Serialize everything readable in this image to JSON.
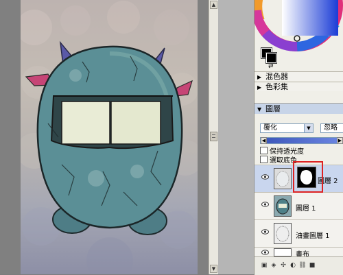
{
  "panels": {
    "mixer_label": "混色器",
    "swatches_label": "色彩集",
    "layers_label": "圖層"
  },
  "layers_panel": {
    "composite_method": "覆化",
    "opacity_label": "忽略",
    "preserve_transparency": "保持透光度",
    "pick_underlying": "選取底色",
    "layers": [
      {
        "name": "圖層 2",
        "selected": true,
        "has_mask": true
      },
      {
        "name": "圖層 1",
        "selected": false
      },
      {
        "name": "油畫圖層 1",
        "selected": false
      },
      {
        "name": "畫布",
        "selected": false
      }
    ]
  },
  "colors": {
    "accent_highlight": "#d22222",
    "selected_row": "#c9d6ee",
    "panel_bg": "#f0efe8",
    "primary_color": "#000000",
    "secondary_color": "#000000"
  }
}
